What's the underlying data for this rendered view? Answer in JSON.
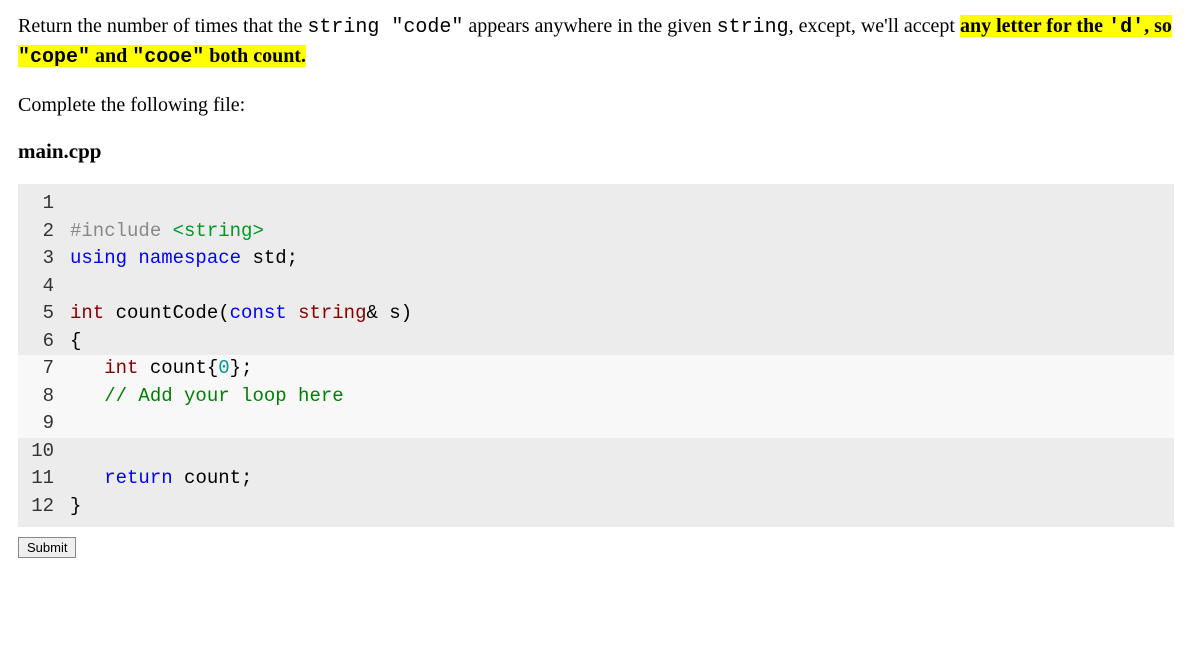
{
  "problem": {
    "part1": "Return the number of times that the ",
    "mono1": "string \"code\"",
    "part2": " appears anywhere in the given ",
    "mono2": "string",
    "part3": ", except, we'll accept ",
    "hl_part1": "any letter for the ",
    "hl_mono": "'d'",
    "hl_part2": ", so ",
    "hl_mono2": "\"cope\"",
    "hl_part3": " and ",
    "hl_mono3": "\"cooe\"",
    "hl_part4": " both count."
  },
  "instruction": "Complete the following file:",
  "filename": "main.cpp",
  "code": {
    "lines": [
      {
        "n": "1",
        "editable": false
      },
      {
        "n": "2",
        "editable": false
      },
      {
        "n": "3",
        "editable": false
      },
      {
        "n": "4",
        "editable": false
      },
      {
        "n": "5",
        "editable": false
      },
      {
        "n": "6",
        "editable": false
      },
      {
        "n": "7",
        "editable": true
      },
      {
        "n": "8",
        "editable": true
      },
      {
        "n": "9",
        "editable": true
      },
      {
        "n": "10",
        "editable": false
      },
      {
        "n": "11",
        "editable": false
      },
      {
        "n": "12",
        "editable": false
      }
    ],
    "l2_pp": "#include",
    "l2_inc": "<string>",
    "l3_kw1": "using",
    "l3_kw2": "namespace",
    "l3_rest": " std;",
    "l5_type1": "int",
    "l5_fn": " countCode(",
    "l5_kw": "const",
    "l5_type2": "string",
    "l5_rest": "& s)",
    "l6": "{",
    "l7_pad": "   ",
    "l7_type": "int",
    "l7_mid": " count{",
    "l7_num": "0",
    "l7_end": "};",
    "l8_pad": "   ",
    "l8_comment": "// Add your loop here",
    "l11_pad": "   ",
    "l11_kw": "return",
    "l11_rest": " count;",
    "l12": "}"
  },
  "submit_label": "Submit"
}
